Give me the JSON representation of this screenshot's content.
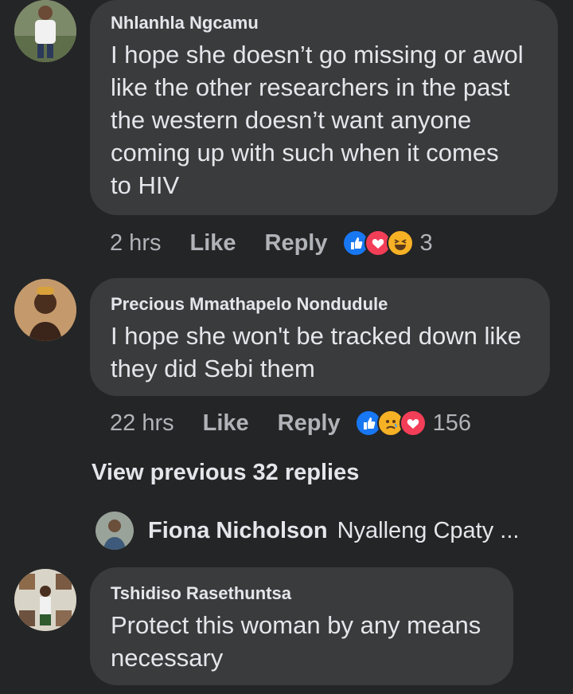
{
  "comments": [
    {
      "author": "Nhlanhla Ngcamu",
      "text_lines": [
        "I hope she doesn’t go missing or awol",
        "like the other researchers in the past",
        "the western doesn’t want anyone",
        "coming up with such when it comes",
        "to HIV"
      ],
      "time": "2 hrs",
      "like_label": "Like",
      "reply_label": "Reply",
      "reactions": [
        "like-icon",
        "love-icon",
        "haha-icon"
      ],
      "reaction_count": "3"
    },
    {
      "author": "Precious Mmathapelo Nondudule",
      "text_lines": [
        "I hope she won't be tracked down like",
        "they did Sebi them"
      ],
      "time": "22 hrs",
      "like_label": "Like",
      "reply_label": "Reply",
      "reactions": [
        "like-icon",
        "sad-icon",
        "love-icon"
      ],
      "reaction_count": "156"
    },
    {
      "author": "Tshidiso Rasethuntsa",
      "text_lines": [
        "Protect this woman by any means",
        "necessary"
      ]
    }
  ],
  "view_previous": "View previous 32 replies",
  "latest_reply": {
    "author": "Fiona Nicholson",
    "text": "Nyalleng Cpaty ..."
  },
  "colors": {
    "background": "#242526",
    "bubble": "#3a3b3c",
    "text": "#e4e6eb",
    "secondary": "#b0b3b8",
    "like_blue": "#1877f2",
    "love_red": "#f33e58",
    "haha_yellow": "#f7b125"
  }
}
